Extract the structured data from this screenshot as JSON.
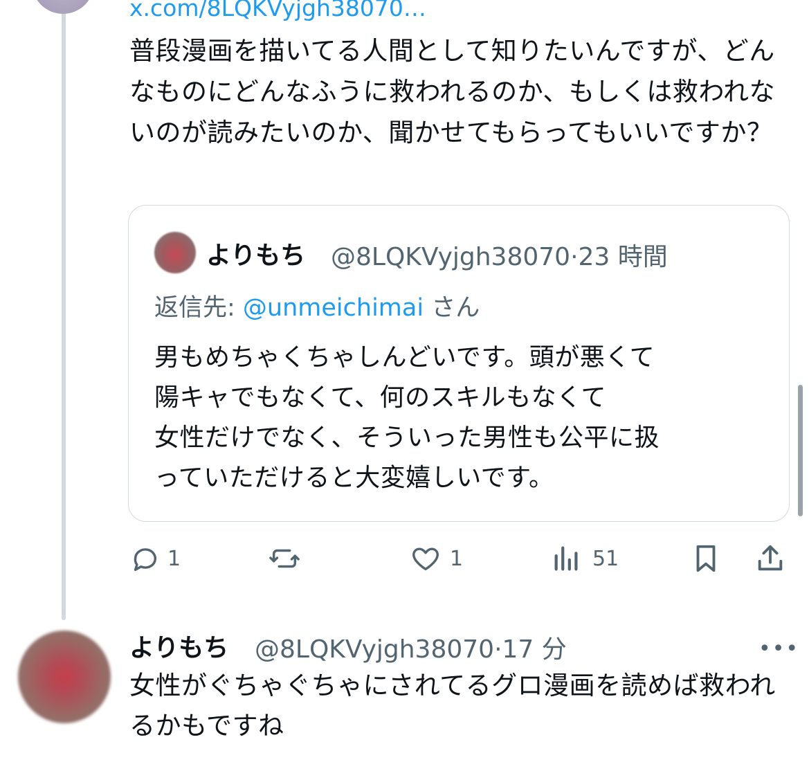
{
  "tweet": {
    "link_text": "x.com/8LQKVyjgh38070…",
    "text": "普段漫画を描いてる人間として知りたいんですが、どんなものにどんなふうに救われるのか、もしくは救われないのが読みたいのか、聞かせてもらってもいいですか？",
    "quote": {
      "name": "よりもち",
      "handle": "@8LQKVyjgh38070",
      "separator": "·",
      "time": "23 時間",
      "reply_prefix": "返信先: ",
      "reply_mention": "@unmeichimai",
      "reply_suffix": " さん",
      "text": "男もめちゃくちゃしんどいです。頭が悪くて\n陽キャでもなくて、何のスキルもなくて\n女性だけでなく、そういった男性も公平に扱\nっていただけると大変嬉しいです。"
    },
    "actions": {
      "reply_count": "1",
      "repost_count": "",
      "like_count": "1",
      "views_count": "51"
    }
  },
  "reply": {
    "name": "よりもち",
    "handle": "@8LQKVyjgh38070",
    "separator": "·",
    "time": "17 分",
    "more": "•••",
    "text": "女性がぐちゃぐちゃにされてるグロ漫画を読めば救われるかもですね"
  },
  "colors": {
    "accent": "#1d9bf0",
    "secondary_text": "#536471",
    "border": "#cfd9de"
  }
}
